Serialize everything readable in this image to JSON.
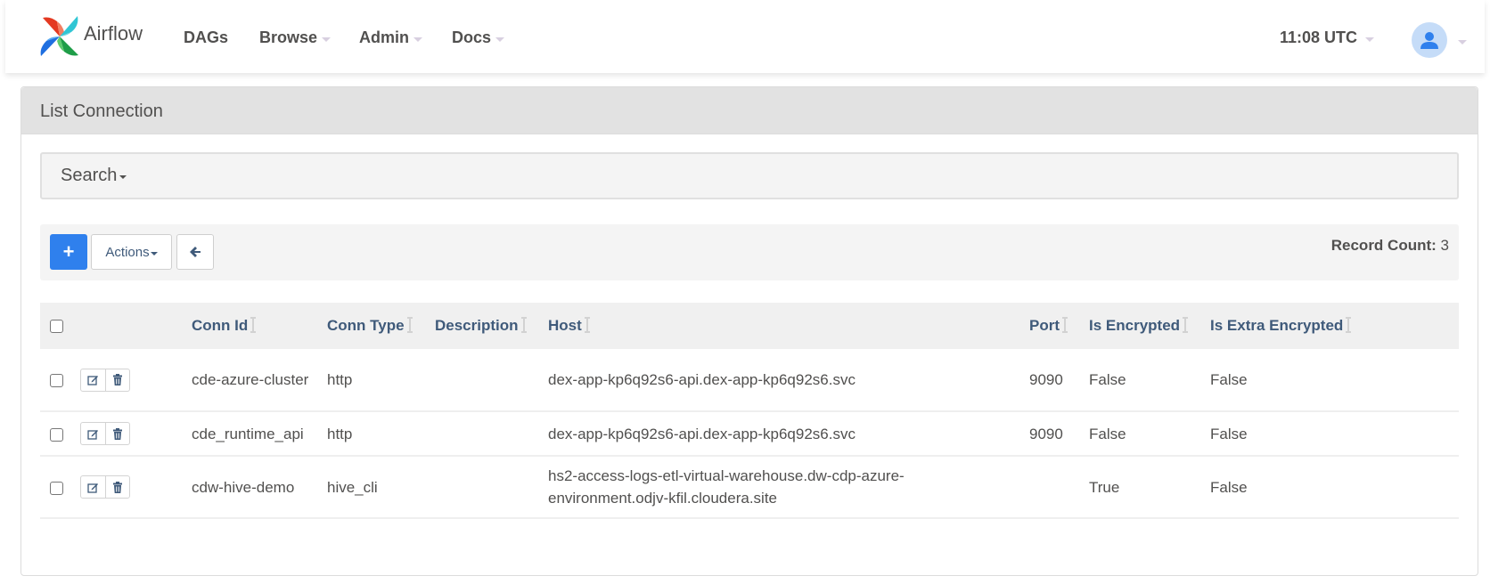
{
  "navbar": {
    "brand": "Airflow",
    "items": [
      {
        "label": "DAGs",
        "has_dropdown": false
      },
      {
        "label": "Browse",
        "has_dropdown": true
      },
      {
        "label": "Admin",
        "has_dropdown": true
      },
      {
        "label": "Docs",
        "has_dropdown": true
      }
    ],
    "time": "11:08 UTC",
    "user_icon": "user-icon"
  },
  "panel": {
    "title": "List Connection",
    "search_label": "Search",
    "toolbar": {
      "add_icon": "+",
      "actions_label": "Actions",
      "back_icon": "arrow-left-icon",
      "record_count_label": "Record Count:",
      "record_count_value": "3"
    }
  },
  "table": {
    "columns": [
      "Conn Id",
      "Conn Type",
      "Description",
      "Host",
      "Port",
      "Is Encrypted",
      "Is Extra Encrypted"
    ],
    "rows": [
      {
        "conn_id": "cde-azure-cluster",
        "conn_type": "http",
        "description": "",
        "host": "dex-app-kp6q92s6-api.dex-app-kp6q92s6.svc",
        "port": "9090",
        "is_encrypted": "False",
        "is_extra_encrypted": "False"
      },
      {
        "conn_id": "cde_runtime_api",
        "conn_type": "http",
        "description": "",
        "host": "dex-app-kp6q92s6-api.dex-app-kp6q92s6.svc",
        "port": "9090",
        "is_encrypted": "False",
        "is_extra_encrypted": "False"
      },
      {
        "conn_id": "cdw-hive-demo",
        "conn_type": "hive_cli",
        "description": "",
        "host": "hs2-access-logs-etl-virtual-warehouse.dw-cdp-azure-environment.odjv-kfil.cloudera.site",
        "port": "",
        "is_encrypted": "True",
        "is_extra_encrypted": "False"
      }
    ]
  },
  "colors": {
    "accent": "#2f80ed",
    "header_text": "#3f5a7a",
    "body_text": "#51504f"
  }
}
